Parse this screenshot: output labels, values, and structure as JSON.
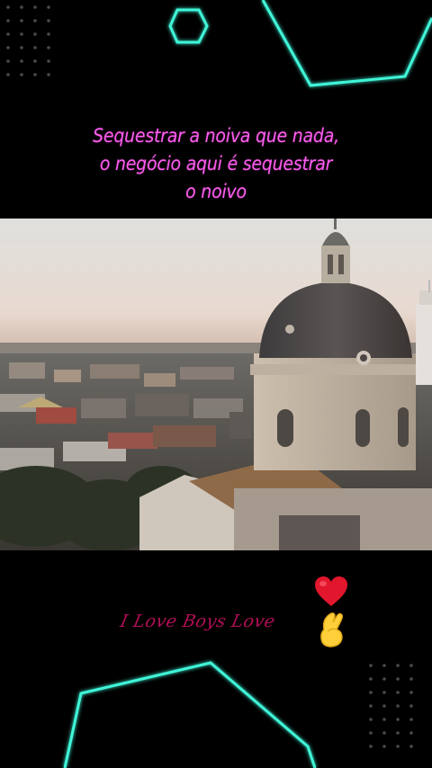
{
  "caption": {
    "lines": [
      "Sequestrar a noiva que nada,",
      "o negócio aqui é sequestrar",
      "o noivo"
    ],
    "color": "#ff5cf0"
  },
  "video": {
    "scene": "aerial-city-dome-at-dusk"
  },
  "signature": {
    "text": "I Love Boys Love",
    "color": "#b10f57"
  },
  "emojis": {
    "heart": "heart-icon",
    "fingers": "crossed-fingers-heart-icon"
  },
  "theme": {
    "background": "#000000",
    "neon": "#3ff5d8",
    "dots": "#4a4a4a"
  }
}
